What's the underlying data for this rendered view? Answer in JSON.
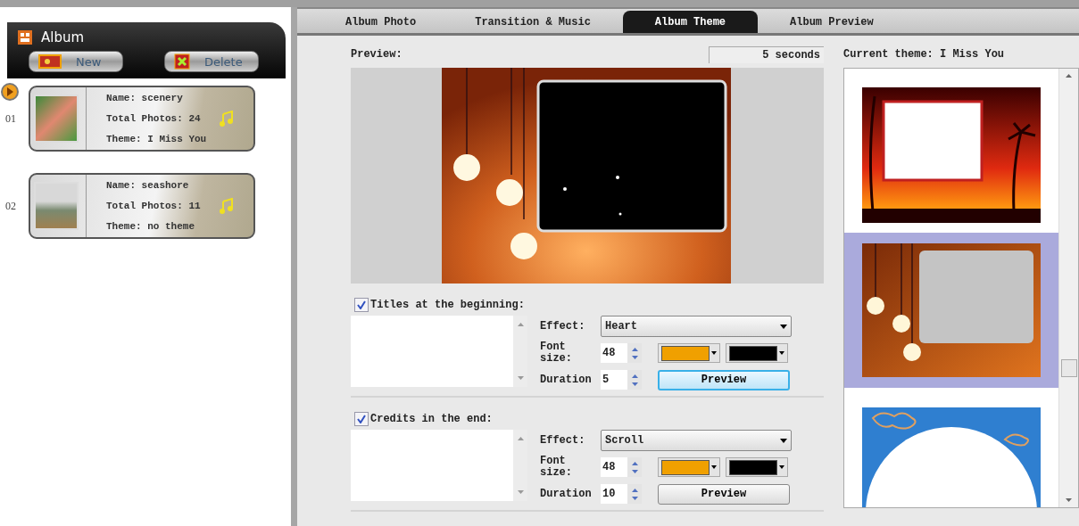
{
  "sidebar": {
    "title": "Album",
    "buttons": [
      {
        "label": "New",
        "kind": "new"
      },
      {
        "label": "Delete",
        "kind": "delete"
      }
    ],
    "albums": [
      {
        "number": "01",
        "selected": true,
        "name": "Name: scenery",
        "photos": "Total Photos: 24",
        "theme": "Theme: I Miss You",
        "kind": "flowers"
      },
      {
        "number": "02",
        "selected": false,
        "name": "Name: seashore",
        "photos": "Total Photos: 11",
        "theme": "Theme: no theme",
        "kind": "landscape"
      }
    ]
  },
  "tabs": [
    {
      "label": "Album Photo",
      "selected": false
    },
    {
      "label": "Transition & Music",
      "selected": false
    },
    {
      "label": "Album Theme",
      "selected": true
    },
    {
      "label": "Album Preview",
      "selected": false
    }
  ],
  "preview": {
    "label": "Preview:",
    "duration": "5 seconds"
  },
  "sections": [
    {
      "label": "Titles at the beginning:",
      "checked": true,
      "effect_label": "Effect:",
      "effect": "Heart",
      "font_size_label": "Font size:",
      "font_size": "48",
      "duration_label": "Duration",
      "duration": "5",
      "swatches": [
        {
          "color": "#f0a000"
        },
        {
          "color": "#000000"
        }
      ],
      "button": "Preview",
      "focused": true
    },
    {
      "label": "Credits in the end:",
      "checked": true,
      "effect_label": "Effect:",
      "effect": "Scroll",
      "font_size_label": "Font size:",
      "font_size": "48",
      "duration_label": "Duration",
      "duration": "10",
      "swatches": [
        {
          "color": "#f0a000"
        },
        {
          "color": "#000000"
        }
      ],
      "button": "Preview",
      "focused": false
    }
  ],
  "themes": {
    "label": "Current theme: I Miss You",
    "items": [
      {
        "kind": "sunset",
        "selected": false
      },
      {
        "kind": "lights",
        "selected": true
      },
      {
        "kind": "moon",
        "selected": false
      }
    ]
  }
}
